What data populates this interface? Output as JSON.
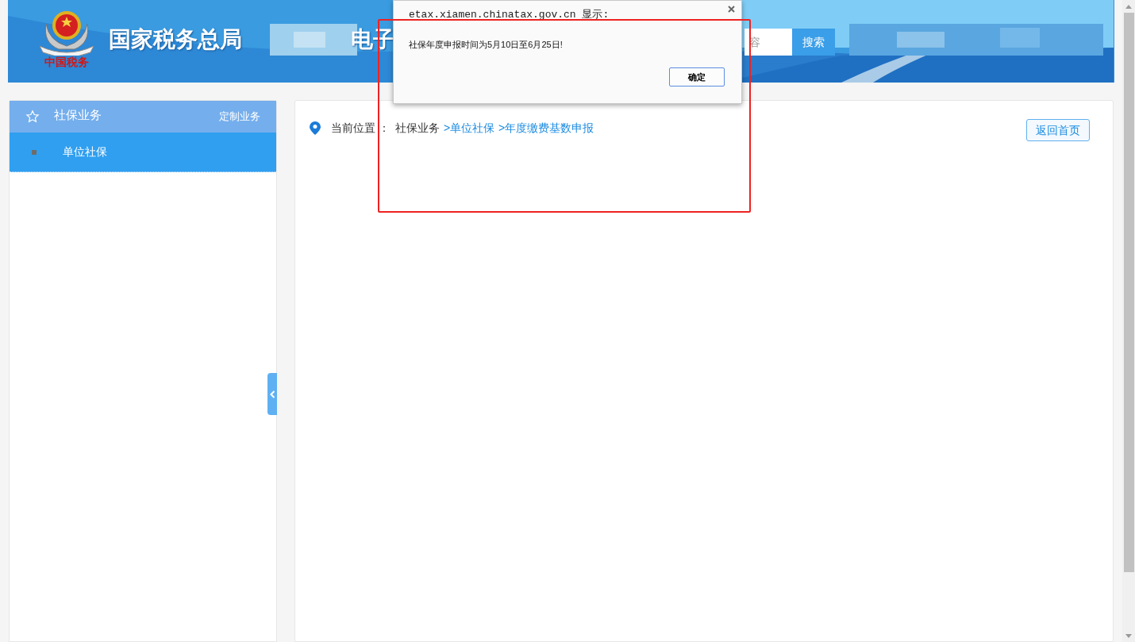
{
  "header": {
    "logo_caption": "中国税务",
    "title": "国家税务总局",
    "title_tail": "电子",
    "search": {
      "placeholder": "容"
    },
    "search_button": "搜索"
  },
  "sidebar": {
    "title": "社保业务",
    "action": "定制业务",
    "items": [
      {
        "label": "单位社保",
        "selected": true
      }
    ]
  },
  "breadcrumb": {
    "label": "当前位置 ：",
    "items": [
      {
        "text": "社保业务",
        "link": false
      },
      {
        "text": ">单位社保",
        "link": true
      },
      {
        "text": ">年度缴费基数申报",
        "link": true
      }
    ]
  },
  "home_button": "返回首页",
  "dialog": {
    "title": "etax.xiamen.chinatax.gov.cn 显示:",
    "message": "社保年度申报时间为5月10日至6月25日!",
    "ok": "确定"
  }
}
